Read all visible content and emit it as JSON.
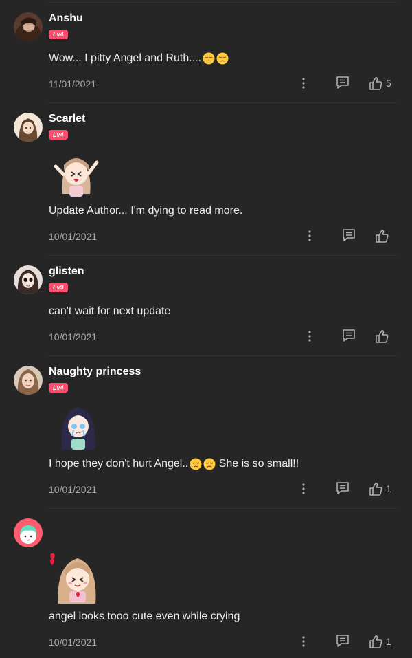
{
  "colors": {
    "background": "#262626",
    "level_badge": "#ff4d6d",
    "divider": "#333333",
    "text": "#ececec",
    "muted": "#a8a8a8"
  },
  "comments": [
    {
      "username": "Anshu",
      "level": "Lv4",
      "text": "Wow... I pitty Angel and Ruth....",
      "emoji": [
        "pensive-face",
        "pensive-face"
      ],
      "date": "11/01/2021",
      "likes": "5"
    },
    {
      "username": "Scarlet",
      "level": "Lv4",
      "sticker": "anime-girl-cheering-sticker",
      "text": "Update Author... I'm dying to read more.",
      "date": "10/01/2021",
      "likes": ""
    },
    {
      "username": "glisten",
      "level": "Lv9",
      "text": "can't wait for next update",
      "date": "10/01/2021",
      "likes": ""
    },
    {
      "username": "Naughty princess",
      "level": "Lv4",
      "sticker": "anime-girl-crying-sticker",
      "text_before": "I hope they don't hurt Angel..",
      "emoji": [
        "pensive-face",
        "pensive-face"
      ],
      "text_after": " She is so small!!",
      "date": "10/01/2021",
      "likes": "1"
    },
    {
      "username": "",
      "level": "",
      "sticker": "anime-girl-heart-sticker",
      "text": "angel looks tooo cute even while crying",
      "date": "10/01/2021",
      "likes": "1"
    }
  ]
}
